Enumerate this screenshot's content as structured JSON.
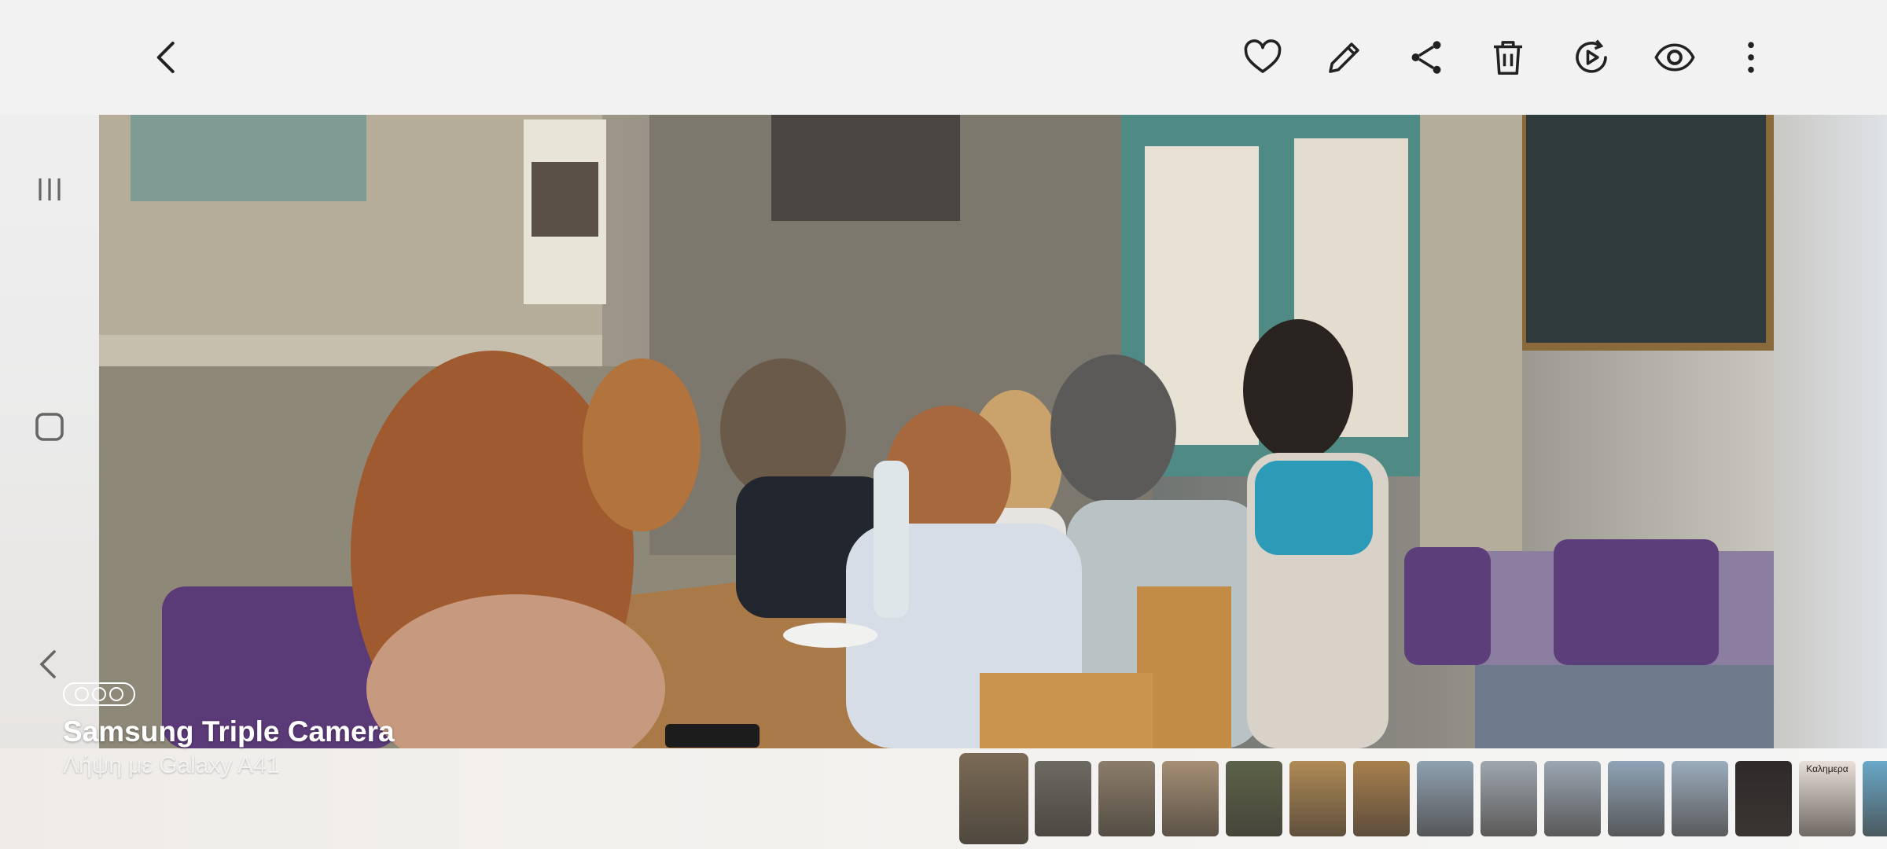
{
  "toolbar": {
    "back_icon": "chevron-left-icon",
    "actions": [
      "heart-icon",
      "pencil-icon",
      "share-icon",
      "trash-icon",
      "motion-play-icon",
      "eye-icon",
      "more-vertical-icon"
    ]
  },
  "nav": {
    "recents_icon": "recents-icon",
    "home_icon": "home-icon",
    "back_icon": "back-icon"
  },
  "photo_info": {
    "camera_title": "Samsung Triple Camera",
    "camera_subtitle": "Λήψη με Galaxy A41"
  },
  "thumbnails": [
    {
      "name": "thumb-1",
      "selected": true,
      "color": "#7a6a55"
    },
    {
      "name": "thumb-2",
      "color": "#6d6a62"
    },
    {
      "name": "thumb-3",
      "color": "#8b7d6a"
    },
    {
      "name": "thumb-4",
      "color": "#a58f75"
    },
    {
      "name": "thumb-5",
      "color": "#5c6248"
    },
    {
      "name": "thumb-6",
      "color": "#b08a55"
    },
    {
      "name": "thumb-7",
      "color": "#a77f4d"
    },
    {
      "name": "thumb-8",
      "color": "#8fa1b0"
    },
    {
      "name": "thumb-9",
      "color": "#9fa7ae"
    },
    {
      "name": "thumb-10",
      "color": "#9aa6b2"
    },
    {
      "name": "thumb-11",
      "color": "#8fa3b5"
    },
    {
      "name": "thumb-12",
      "color": "#9bacbc"
    },
    {
      "name": "thumb-13",
      "color": "#2e2a2a"
    },
    {
      "name": "thumb-14",
      "color": "#e8e0d8",
      "text": "Καλημερα"
    },
    {
      "name": "thumb-15",
      "color": "#6aa8c8"
    }
  ]
}
